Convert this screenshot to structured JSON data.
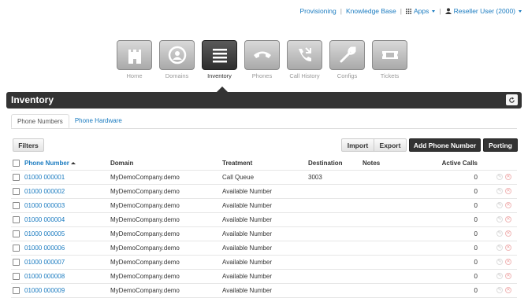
{
  "topnav": {
    "provisioning": "Provisioning",
    "knowledge_base": "Knowledge Base",
    "apps": "Apps",
    "user": "Reseller User (2000)",
    "separator": "|"
  },
  "iconbar": [
    {
      "label": "Home",
      "icon": "castle-icon"
    },
    {
      "label": "Domains",
      "icon": "domains-icon"
    },
    {
      "label": "Inventory",
      "icon": "inventory-list-icon",
      "active": true
    },
    {
      "label": "Phones",
      "icon": "phone-handset-icon"
    },
    {
      "label": "Call History",
      "icon": "call-history-icon"
    },
    {
      "label": "Configs",
      "icon": "wrench-icon"
    },
    {
      "label": "Tickets",
      "icon": "ticket-icon"
    }
  ],
  "page": {
    "title": "Inventory",
    "refresh_icon": "refresh-icon"
  },
  "tabs": {
    "phone_numbers": "Phone Numbers",
    "phone_hardware": "Phone Hardware"
  },
  "toolbar": {
    "filters": "Filters",
    "import": "Import",
    "export": "Export",
    "add": "Add Phone Number",
    "porting": "Porting"
  },
  "table": {
    "headers": {
      "phone_number": "Phone Number",
      "domain": "Domain",
      "treatment": "Treatment",
      "destination": "Destination",
      "notes": "Notes",
      "active_calls": "Active Calls"
    },
    "rows": [
      {
        "number": "01000 000001",
        "domain": "MyDemoCompany.demo",
        "treatment": "Call Queue",
        "destination": "3003",
        "notes": "",
        "active": "0"
      },
      {
        "number": "01000 000002",
        "domain": "MyDemoCompany.demo",
        "treatment": "Available Number",
        "destination": "",
        "notes": "",
        "active": "0"
      },
      {
        "number": "01000 000003",
        "domain": "MyDemoCompany.demo",
        "treatment": "Available Number",
        "destination": "",
        "notes": "",
        "active": "0"
      },
      {
        "number": "01000 000004",
        "domain": "MyDemoCompany.demo",
        "treatment": "Available Number",
        "destination": "",
        "notes": "",
        "active": "0"
      },
      {
        "number": "01000 000005",
        "domain": "MyDemoCompany.demo",
        "treatment": "Available Number",
        "destination": "",
        "notes": "",
        "active": "0"
      },
      {
        "number": "01000 000006",
        "domain": "MyDemoCompany.demo",
        "treatment": "Available Number",
        "destination": "",
        "notes": "",
        "active": "0"
      },
      {
        "number": "01000 000007",
        "domain": "MyDemoCompany.demo",
        "treatment": "Available Number",
        "destination": "",
        "notes": "",
        "active": "0"
      },
      {
        "number": "01000 000008",
        "domain": "MyDemoCompany.demo",
        "treatment": "Available Number",
        "destination": "",
        "notes": "",
        "active": "0"
      },
      {
        "number": "01000 000009",
        "domain": "MyDemoCompany.demo",
        "treatment": "Available Number",
        "destination": "",
        "notes": "",
        "active": "0"
      }
    ]
  },
  "colors": {
    "link": "#1a7bc0",
    "dark": "#333333",
    "delete": "#e06060"
  }
}
